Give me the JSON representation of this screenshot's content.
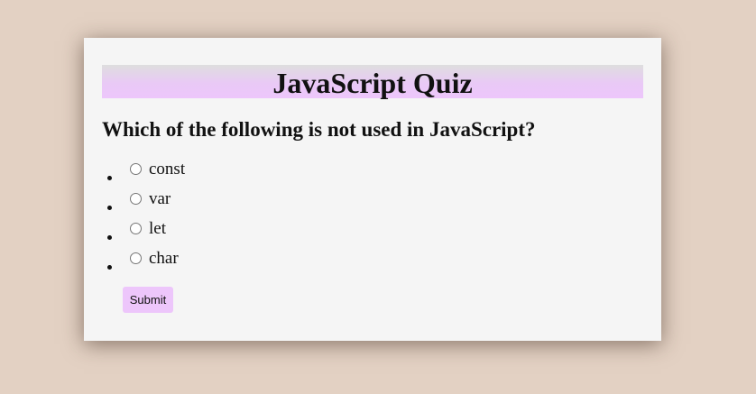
{
  "quiz": {
    "title": "JavaScript Quiz",
    "question": "Which of the following is not used in JavaScript?",
    "options": [
      {
        "label": "const",
        "selected": false
      },
      {
        "label": "var",
        "selected": false
      },
      {
        "label": "let",
        "selected": false
      },
      {
        "label": "char",
        "selected": false
      }
    ],
    "submit_label": "Submit"
  },
  "colors": {
    "page_background": "#e3d1c3",
    "card_background": "#f5f5f5",
    "accent": "#edc6fb"
  }
}
